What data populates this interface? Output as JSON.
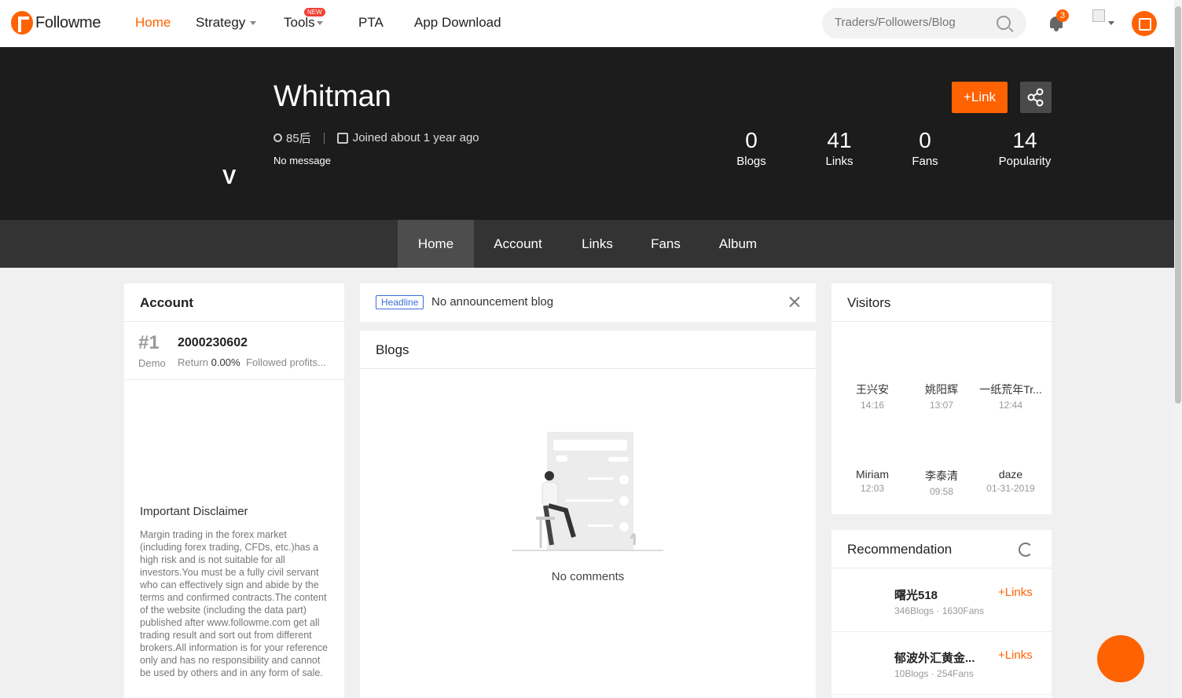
{
  "nav": {
    "logo": "Followme",
    "items": [
      "Home",
      "Strategy",
      "Tools",
      "PTA",
      "App Download"
    ],
    "new_badge": "NEW",
    "search_placeholder": "Traders/Followers/Blog",
    "notification_count": "3"
  },
  "profile": {
    "initial": "V",
    "name": "Whitman",
    "generation": "85后",
    "joined": "Joined about 1 year ago",
    "message": "No message",
    "link_button": "+Link",
    "stats": [
      {
        "value": "0",
        "label": "Blogs"
      },
      {
        "value": "41",
        "label": "Links"
      },
      {
        "value": "0",
        "label": "Fans"
      },
      {
        "value": "14",
        "label": "Popularity"
      }
    ],
    "tabs": [
      "Home",
      "Account",
      "Links",
      "Fans",
      "Album"
    ]
  },
  "account": {
    "title": "Account",
    "rank": "#1",
    "id": "2000230602",
    "type": "Demo",
    "return_label": "Return",
    "return_value": "0.00%",
    "followed_profits": "Followed profits...",
    "disclaimer_title": "Important Disclaimer",
    "disclaimer_text": "Margin trading in the forex market (including forex trading, CFDs, etc.)has a high risk and is not suitable for all investors.You must be a fully civil servant who can effectively sign and abide by the terms and confirmed contracts.The content of the website (including the data part) published after www.followme.com get all trading result and sort out from different brokers.All information is for your reference only and has no responsibility and cannot be used by others and in any form of sale."
  },
  "headline": {
    "tag": "Headline",
    "text": "No announcement blog"
  },
  "blogs": {
    "title": "Blogs",
    "empty_text": "No comments"
  },
  "visitors": {
    "title": "Visitors",
    "items": [
      {
        "name": "王兴安",
        "time": "14:16"
      },
      {
        "name": "姚阳辉",
        "time": "13:07"
      },
      {
        "name": "一纸荒年Tr...",
        "time": "12:44"
      },
      {
        "name": "Miriam",
        "time": "12:03"
      },
      {
        "name": "李泰清",
        "time": "09:58"
      },
      {
        "name": "daze",
        "time": "01-31-2019"
      }
    ]
  },
  "recommendation": {
    "title": "Recommendation",
    "items": [
      {
        "name": "曙光518",
        "sub": "346Blogs · 1630Fans",
        "action": "+Links"
      },
      {
        "name": "郁波外汇黄金...",
        "sub": "10Blogs · 254Fans",
        "action": "+Links"
      }
    ]
  },
  "colors": {
    "accent": "#ff6200",
    "hero_bg": "#1c1c1c",
    "tabs_bg": "#333333"
  }
}
